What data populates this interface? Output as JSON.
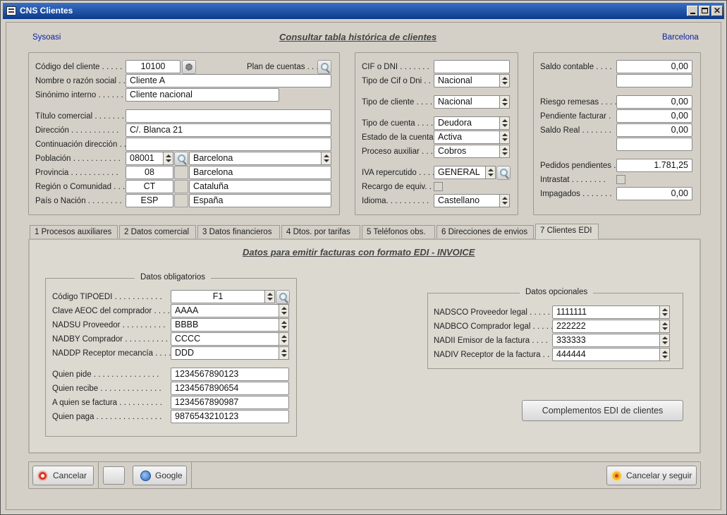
{
  "window": {
    "title": "CNS Clientes"
  },
  "header": {
    "left": "Sysoasi",
    "title": "Consultar tabla histórica de clientes",
    "right": "Barcelona"
  },
  "client": {
    "codigo_label": "Código del cliente . . . . .",
    "codigo": "10100",
    "plan_label": "Plan de cuentas . . .",
    "nombre_label": "Nombre o razón social . .",
    "nombre": "Cliente A",
    "sinonimo_label": "Sinónimo interno . . . . . .",
    "sinonimo": "Cliente nacional",
    "titulo_label": "Título comercial . . . . . . .",
    "titulo": "",
    "direccion_label": "Dirección . . . . . . . . . . .",
    "direccion": "C/. Blanca 21",
    "continuacion_label": "Continuación dirección . .",
    "continuacion": "",
    "poblacion_label": "Población . . . . . . . . . . .",
    "poblacion_cp": "08001",
    "poblacion": "Barcelona",
    "provincia_label": "Provincia . . . . . . . . . . .",
    "provincia_code": "08",
    "provincia": "Barcelona",
    "region_label": "Región o Comunidad . . .",
    "region_code": "CT",
    "region": "Cataluña",
    "pais_label": "País o Nación . . . . . . . .",
    "pais_code": "ESP",
    "pais": "España"
  },
  "fiscal": {
    "cif_label": "CIF o DNI . . . . . . .",
    "cif": "",
    "tipo_cif_label": "Tipo de Cif o Dni . .",
    "tipo_cif": "Nacional",
    "tipo_cliente_label": "Tipo de cliente . . . .",
    "tipo_cliente": "Nacional",
    "tipo_cuenta_label": "Tipo de cuenta . . . .",
    "tipo_cuenta": "Deudora",
    "estado_label": "Estado de la cuenta .",
    "estado": "Activa",
    "proceso_label": "Proceso auxiliar . . .",
    "proceso": "Cobros",
    "iva_label": "IVA repercutido . . . .",
    "iva": "GENERAL",
    "recargo_label": "Recargo de equiv. . .",
    "idioma_label": "Idioma. . . . . . . . . .",
    "idioma": "Castellano"
  },
  "saldos": {
    "saldo_contable_label": "Saldo contable . . . .",
    "saldo_contable": "0,00",
    "riesgo_label": "Riesgo remesas . . . .",
    "riesgo": "0,00",
    "pendiente_label": "Pendiente facturar .",
    "pendiente": "0,00",
    "saldo_real_label": "Saldo Real . . . . . . .",
    "saldo_real": "0,00",
    "pedidos_label": "Pedidos pendientes .",
    "pedidos": "1.781,25",
    "intrastat_label": "Intrastat . . . . . . . .",
    "impagados_label": "Impagados . . . . . . .",
    "impagados": "0,00"
  },
  "tabs": [
    "1  Procesos auxiliares",
    "2  Datos comercial",
    "3  Datos financieros",
    "4  Dtos. por tarifas",
    "5  Teléfonos obs.",
    "6  Direcciones de envios",
    "7  Clientes EDI"
  ],
  "edi": {
    "title": "Datos para emitir facturas con formato EDI - INVOICE",
    "obligatorios_title": "Datos obligatorios",
    "tipoedi_label": "Código TIPOEDI . . . . . . . . . . .",
    "tipoedi": "F1",
    "aeoc_label": "Clave AEOC del comprador . . . .",
    "aeoc": "AAAA",
    "nadsu_label": "NADSU  Proveedor . . . . . . . . . .",
    "nadsu": "BBBB",
    "nadby_label": "NADBY  Comprador . . . . . . . . . .",
    "nadby": "CCCC",
    "naddp_label": "NADDP  Receptor mecancía . . . .",
    "naddp": "DDD",
    "quien_pide_label": "Quien pide . . . . . . . . . . . . . . .",
    "quien_pide": "1234567890123",
    "quien_recibe_label": "Quien recibe . . . . . . . . . . . . . .",
    "quien_recibe": "1234567890654",
    "a_quien_label": "A quien se factura . . . . . . . . . .",
    "a_quien": "1234567890987",
    "quien_paga_label": "Quien paga . . . . . . . . . . . . . . .",
    "quien_paga": "9876543210123",
    "opcionales_title": "Datos opcionales",
    "nadsco_label": "NADSCO  Proveedor legal . . . . .",
    "nadsco": "1111111",
    "nadbco_label": "NADBCO  Comprador legal . . . . .",
    "nadbco": "222222",
    "nadii_label": "NADII  Emisor de la factura . . . .",
    "nadii": "333333",
    "nadiv_label": "NADIV  Receptor de la factura . .",
    "nadiv": "444444",
    "complementos_label": "Complementos EDI de clientes"
  },
  "footer": {
    "cancelar": "Cancelar",
    "google": "Google",
    "cancelar_seguir": "Cancelar y seguir"
  },
  "colors": {
    "titlebar": "#0a3a8a",
    "link_blue": "#0b1ea0",
    "background": "#d4d0c8"
  }
}
